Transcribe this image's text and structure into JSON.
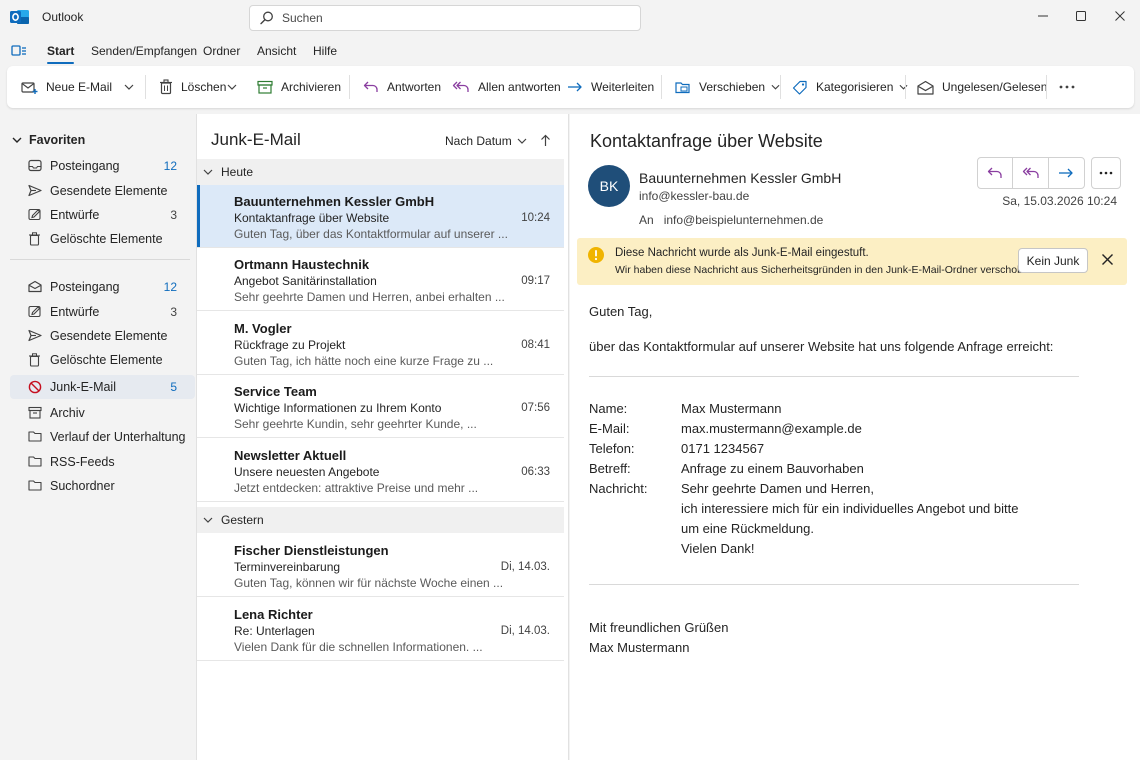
{
  "app": {
    "title": "Outlook"
  },
  "search": {
    "placeholder": "Suchen"
  },
  "menu": {
    "tabs": [
      "Start",
      "Senden/Empfangen",
      "Ordner",
      "Ansicht",
      "Hilfe"
    ]
  },
  "ribbon": {
    "new_mail": "Neue E-Mail",
    "delete": "Löschen",
    "archive": "Archivieren",
    "reply": "Antworten",
    "reply_all": "Allen antworten",
    "forward": "Weiterleiten",
    "move": "Verschieben",
    "categorize": "Kategorisieren",
    "unread_read": "Ungelesen/Gelesen"
  },
  "folders": {
    "favorites_label": "Favoriten",
    "favorites": [
      {
        "label": "Posteingang",
        "count": "12"
      },
      {
        "label": "Gesendete Elemente",
        "count": ""
      },
      {
        "label": "Entwürfe",
        "count": "3"
      },
      {
        "label": "Gelöschte Elemente",
        "count": ""
      }
    ],
    "all": [
      {
        "label": "Posteingang",
        "count": "12"
      },
      {
        "label": "Entwürfe",
        "count": "3"
      },
      {
        "label": "Gesendete Elemente",
        "count": ""
      },
      {
        "label": "Gelöschte Elemente",
        "count": ""
      },
      {
        "label": "Junk-E-Mail",
        "count": "5"
      },
      {
        "label": "Archiv",
        "count": ""
      },
      {
        "label": "Verlauf der Unterhaltung",
        "count": ""
      },
      {
        "label": "RSS-Feeds",
        "count": ""
      },
      {
        "label": "Suchordner",
        "count": ""
      }
    ]
  },
  "list": {
    "title": "Junk-E-Mail",
    "sort_label": "Nach Datum",
    "groups": [
      {
        "label": "Heute",
        "items": [
          {
            "sender": "Bauunternehmen Kessler GmbH",
            "subject": "Kontaktanfrage über Website",
            "preview": "Guten Tag, über das Kontaktformular auf unserer ...",
            "time": "10:24"
          },
          {
            "sender": "Ortmann Haustechnik",
            "subject": "Angebot Sanitärinstallation",
            "preview": "Sehr geehrte Damen und Herren, anbei erhalten ...",
            "time": "09:17"
          },
          {
            "sender": "M. Vogler",
            "subject": "Rückfrage zu Projekt",
            "preview": "Guten Tag, ich hätte noch eine kurze Frage zu ...",
            "time": "08:41"
          },
          {
            "sender": "Service Team",
            "subject": "Wichtige Informationen zu Ihrem Konto",
            "preview": "Sehr geehrte Kundin, sehr geehrter Kunde, ...",
            "time": "07:56"
          },
          {
            "sender": "Newsletter Aktuell",
            "subject": "Unsere neuesten Angebote",
            "preview": "Jetzt entdecken: attraktive Preise und mehr ...",
            "time": "06:33"
          }
        ]
      },
      {
        "label": "Gestern",
        "items": [
          {
            "sender": "Fischer Dienstleistungen",
            "subject": "Terminvereinbarung",
            "preview": "Guten Tag, können wir für nächste Woche einen ...",
            "time": "Di, 14.03."
          },
          {
            "sender": "Lena Richter",
            "subject": "Re: Unterlagen",
            "preview": "Vielen Dank für die schnellen Informationen. ...",
            "time": "Di, 14.03."
          }
        ]
      }
    ]
  },
  "reading": {
    "subject": "Kontaktanfrage über Website",
    "avatar_initials": "BK",
    "sender_name": "Bauunternehmen Kessler GmbH",
    "sender_email": "info@kessler-bau.de",
    "to_label": "An",
    "to_email": "info@beispielunternehmen.de",
    "date": "Sa, 15.03.2026 10:24",
    "junk_title": "Diese Nachricht wurde als Junk-E-Mail eingestuft.",
    "junk_detail": "Wir haben diese Nachricht aus Sicherheitsgründen in den Junk-E-Mail-Ordner verschoben.",
    "not_junk_label": "Kein Junk",
    "greeting": "Guten Tag,",
    "intro": "über das Kontaktformular auf unserer Website hat uns folgende Anfrage erreicht:",
    "fields": [
      {
        "label": "Name:",
        "value": "Max Mustermann"
      },
      {
        "label": "E-Mail:",
        "value": "max.mustermann@example.de"
      },
      {
        "label": "Telefon:",
        "value": "0171 1234567"
      },
      {
        "label": "Betreff:",
        "value": "Anfrage zu einem Bauvorhaben"
      }
    ],
    "message_label": "Nachricht:",
    "message_lines": [
      "Sehr geehrte Damen und Herren,",
      "ich interessiere mich für ein individuelles Angebot und bitte",
      "um eine Rückmeldung.",
      "Vielen Dank!"
    ],
    "closing": "Mit freundlichen Grüßen",
    "signature": "Max Mustermann"
  },
  "colors": {
    "accent": "#0f6cbd",
    "junk_banner": "#fcefc4",
    "avatar": "#1f4e79",
    "selection": "#dce9f8"
  }
}
